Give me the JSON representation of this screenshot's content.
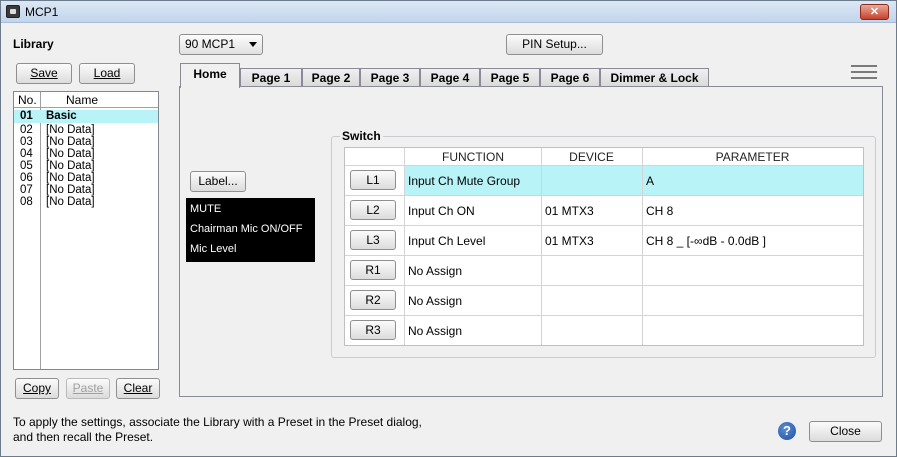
{
  "window": {
    "title": "MCP1",
    "close_glyph": "✕"
  },
  "library": {
    "label": "Library",
    "save": "Save",
    "load": "Load",
    "col_no": "No.",
    "col_name": "Name",
    "items": [
      {
        "no": "01",
        "name": "Basic"
      },
      {
        "no": "02",
        "name": "[No Data]"
      },
      {
        "no": "03",
        "name": "[No Data]"
      },
      {
        "no": "04",
        "name": "[No Data]"
      },
      {
        "no": "05",
        "name": "[No Data]"
      },
      {
        "no": "06",
        "name": "[No Data]"
      },
      {
        "no": "07",
        "name": "[No Data]"
      },
      {
        "no": "08",
        "name": "[No Data]"
      }
    ],
    "copy": "Copy",
    "paste": "Paste",
    "clear": "Clear"
  },
  "device_select": {
    "value": "90 MCP1"
  },
  "pin_setup": "PIN Setup...",
  "tabs": [
    "Home",
    "Page 1",
    "Page 2",
    "Page 3",
    "Page 4",
    "Page 5",
    "Page 6",
    "Dimmer & Lock"
  ],
  "home": {
    "label_button": "Label...",
    "lcd_lines": [
      "MUTE",
      "Chairman Mic ON/OFF",
      "Mic Level"
    ],
    "switch": {
      "title": "Switch",
      "headers": [
        "FUNCTION",
        "DEVICE",
        "PARAMETER"
      ],
      "rows": [
        {
          "key": "L1",
          "function": "Input Ch Mute Group",
          "device": "",
          "parameter": "A"
        },
        {
          "key": "L2",
          "function": "Input Ch ON",
          "device": "01 MTX3",
          "parameter": "CH 8"
        },
        {
          "key": "L3",
          "function": "Input Ch Level",
          "device": "01 MTX3",
          "parameter": "CH 8 _ [-∞dB - 0.0dB ]"
        },
        {
          "key": "R1",
          "function": "No Assign",
          "device": "",
          "parameter": ""
        },
        {
          "key": "R2",
          "function": "No Assign",
          "device": "",
          "parameter": ""
        },
        {
          "key": "R3",
          "function": "No Assign",
          "device": "",
          "parameter": ""
        }
      ]
    }
  },
  "footer": {
    "line1": "To apply the settings, associate the Library with a Preset in the Preset dialog,",
    "line2": "and then recall the Preset.",
    "help": "?",
    "close": "Close"
  },
  "colors": {
    "selection": "#b7f3f7",
    "lcd_bg": "#000000",
    "help_icon": "#1f4f9e"
  }
}
